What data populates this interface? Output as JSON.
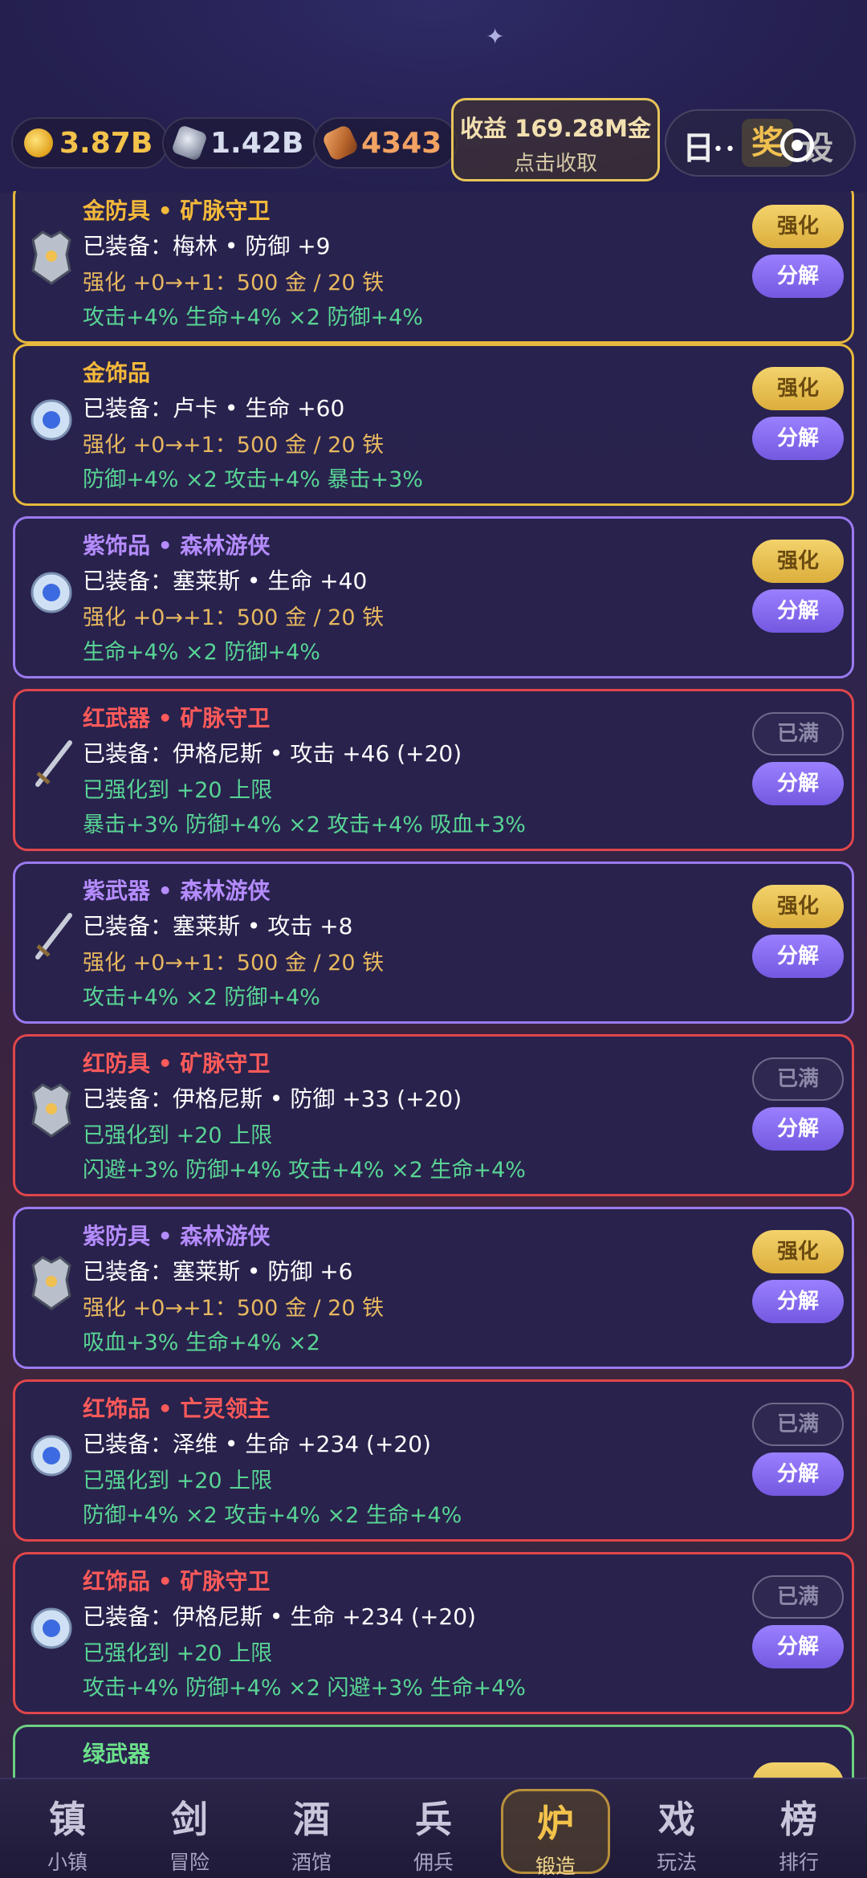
{
  "resources": {
    "gold": "3.87B",
    "iron": "1.42B",
    "wood": "4343"
  },
  "income": {
    "title": "收益 169.28M金",
    "subtitle": "点击收取"
  },
  "top_tabs": {
    "ri": "日",
    "jiang": "奖",
    "she": "设"
  },
  "buttons": {
    "strengthen": "强化",
    "dismantle": "分解",
    "maxed": "已满"
  },
  "items": [
    {
      "title": "金防具 • 矿脉守卫",
      "equip": "已装备：梅林 • 防御 +9",
      "upgrade": "强化 +0→+1：500 金 / 20 铁",
      "bonus": "攻击+4%  生命+4% ×2  防御+4%"
    },
    {
      "title": "金饰品",
      "equip": "已装备：卢卡 • 生命 +60",
      "upgrade": "强化 +0→+1：500 金 / 20 铁",
      "bonus": "防御+4% ×2  攻击+4%  暴击+3%"
    },
    {
      "title": "紫饰品 • 森林游侠",
      "equip": "已装备：塞莱斯 • 生命 +40",
      "upgrade": "强化 +0→+1：500 金 / 20 铁",
      "bonus": "生命+4% ×2  防御+4%"
    },
    {
      "title": "红武器 • 矿脉守卫",
      "equip": "已装备：伊格尼斯 • 攻击 +46 (+20)",
      "upgrade": "已强化到 +20 上限",
      "bonus": "暴击+3%  防御+4% ×2  攻击+4%  吸血+3%"
    },
    {
      "title": "紫武器 • 森林游侠",
      "equip": "已装备：塞莱斯 • 攻击 +8",
      "upgrade": "强化 +0→+1：500 金 / 20 铁",
      "bonus": "攻击+4% ×2  防御+4%"
    },
    {
      "title": "红防具 • 矿脉守卫",
      "equip": "已装备：伊格尼斯 • 防御 +33 (+20)",
      "upgrade": "已强化到 +20 上限",
      "bonus": "闪避+3%  防御+4%  攻击+4% ×2  生命+4%"
    },
    {
      "title": "紫防具 • 森林游侠",
      "equip": "已装备：塞莱斯 • 防御 +6",
      "upgrade": "强化 +0→+1：500 金 / 20 铁",
      "bonus": "吸血+3%  生命+4% ×2"
    },
    {
      "title": "红饰品 • 亡灵领主",
      "equip": "已装备：泽维 • 生命 +234 (+20)",
      "upgrade": "已强化到 +20 上限",
      "bonus": "防御+4% ×2  攻击+4% ×2  生命+4%"
    },
    {
      "title": "红饰品 • 矿脉守卫",
      "equip": "已装备：伊格尼斯 • 生命 +234 (+20)",
      "upgrade": "已强化到 +20 上限",
      "bonus": "攻击+4%  防御+4% ×2  闪避+3%  生命+4%"
    },
    {
      "title": "绿武器"
    }
  ],
  "nav": [
    {
      "ch": "镇",
      "label": "小镇"
    },
    {
      "ch": "剑",
      "label": "冒险"
    },
    {
      "ch": "酒",
      "label": "酒馆"
    },
    {
      "ch": "兵",
      "label": "佣兵"
    },
    {
      "ch": "炉",
      "label": "锻造"
    },
    {
      "ch": "戏",
      "label": "玩法"
    },
    {
      "ch": "榜",
      "label": "排行"
    }
  ],
  "colors": {
    "gold_border": "#e7b93c",
    "purple_border": "#9a7af0",
    "red_border": "#e0464a",
    "green_border": "#6cd080",
    "bonus_text": "#58d494",
    "upgrade_text": "#e8b860"
  }
}
